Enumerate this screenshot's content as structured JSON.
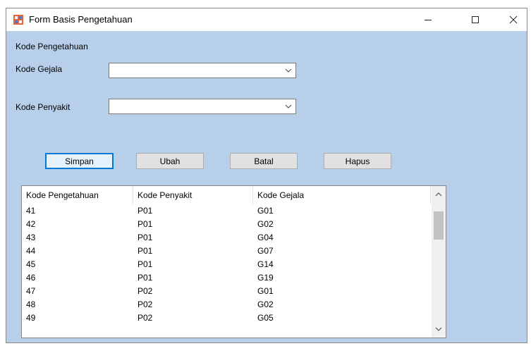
{
  "window": {
    "title": "Form Basis Pengetahuan"
  },
  "form": {
    "section_label": "Kode Pengetahuan",
    "gejala_label": "Kode Gejala",
    "gejala_value": "",
    "penyakit_label": "Kode Penyakit",
    "penyakit_value": ""
  },
  "buttons": {
    "simpan": "Simpan",
    "ubah": "Ubah",
    "batal": "Batal",
    "hapus": "Hapus"
  },
  "table": {
    "columns": [
      "Kode Pengetahuan",
      "Kode Penyakit",
      "Kode Gejala"
    ],
    "rows": [
      [
        "41",
        "P01",
        "G01"
      ],
      [
        "42",
        "P01",
        "G02"
      ],
      [
        "43",
        "P01",
        "G04"
      ],
      [
        "44",
        "P01",
        "G07"
      ],
      [
        "45",
        "P01",
        "G14"
      ],
      [
        "46",
        "P01",
        "G19"
      ],
      [
        "47",
        "P02",
        "G01"
      ],
      [
        "48",
        "P02",
        "G02"
      ],
      [
        "49",
        "P02",
        "G05"
      ]
    ]
  },
  "icons": {
    "app": "form-app-icon",
    "minimize": "minimize-icon",
    "maximize": "maximize-icon",
    "close": "close-icon",
    "dropdown": "chevron-down-icon",
    "scroll_up": "chevron-up-icon",
    "scroll_down": "chevron-down-icon"
  },
  "colors": {
    "client_bg": "#b7cfe8",
    "default_button_border": "#0078d7"
  }
}
